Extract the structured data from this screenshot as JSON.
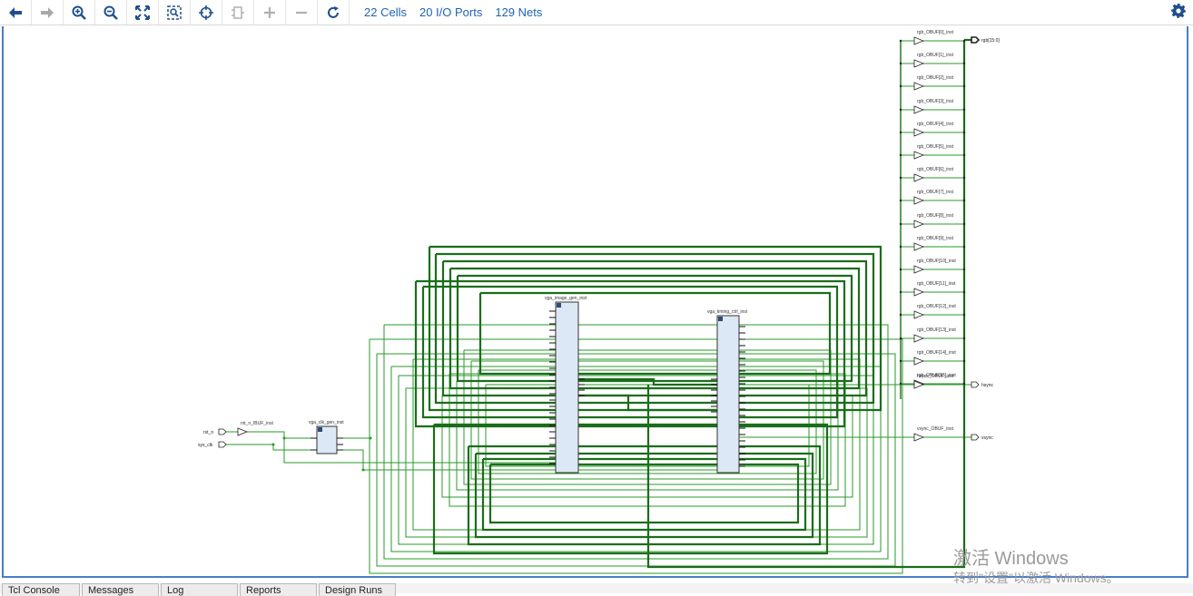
{
  "toolbar": {
    "buttons": [
      {
        "icon": "arrow-left-icon",
        "enabled": true
      },
      {
        "icon": "arrow-right-icon",
        "enabled": false
      },
      {
        "icon": "zoom-in-icon",
        "enabled": true
      },
      {
        "icon": "zoom-out-icon",
        "enabled": true
      },
      {
        "icon": "fit-view-icon",
        "enabled": true
      },
      {
        "icon": "zoom-area-icon",
        "enabled": true
      },
      {
        "icon": "crosshair-icon",
        "enabled": true
      },
      {
        "icon": "regenerate-icon",
        "enabled": false
      },
      {
        "icon": "expand-plus-icon",
        "enabled": false
      },
      {
        "icon": "collapse-minus-icon",
        "enabled": false
      },
      {
        "icon": "refresh-icon",
        "enabled": true
      }
    ],
    "stats": {
      "cells": "22 Cells",
      "io_ports": "20 I/O Ports",
      "nets": "129 Nets"
    },
    "settings_icon": "gear-icon"
  },
  "colors": {
    "accent": "#1f63b6",
    "wire": "#2a9a2a",
    "bus": "#1a6e1a",
    "cell_fill": "#dde8f6",
    "border": "#4a7cc9"
  },
  "schematic": {
    "inputs": {
      "rst": "rst_n",
      "clk": "sys_clk"
    },
    "outputs": {
      "rgb": "rgb[15:0]",
      "hsync": "hsync",
      "vsync": "vsync"
    },
    "cells": {
      "ibuf": "rst_n_IBUF_inst",
      "clk_gen": "vga_clk_gen_inst",
      "image_gen": "vga_image_gen_inst",
      "timing": "vga_timing_ctrl_inst",
      "hsync_buf": "hsync_OBUF_inst",
      "vsync_buf": "vsync_OBUF_inst"
    },
    "rgb_buffers": [
      "rgb_OBUF[0]_inst",
      "rgb_OBUF[1]_inst",
      "rgb_OBUF[2]_inst",
      "rgb_OBUF[3]_inst",
      "rgb_OBUF[4]_inst",
      "rgb_OBUF[5]_inst",
      "rgb_OBUF[6]_inst",
      "rgb_OBUF[7]_inst",
      "rgb_OBUF[8]_inst",
      "rgb_OBUF[9]_inst",
      "rgb_OBUF[10]_inst",
      "rgb_OBUF[11]_inst",
      "rgb_OBUF[12]_inst",
      "rgb_OBUF[13]_inst",
      "rgb_OBUF[14]_inst",
      "rgb_OBUF[15]_inst"
    ]
  },
  "watermark": {
    "title": "激活 Windows",
    "subtitle": "转到\"设置\"以激活 Windows。"
  },
  "tabs": [
    "Tcl Console",
    "Messages",
    "Log",
    "Reports",
    "Design Runs"
  ]
}
